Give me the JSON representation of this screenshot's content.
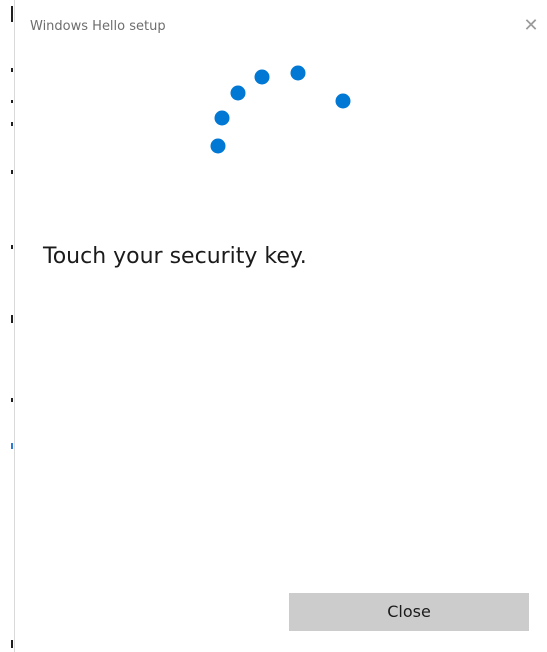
{
  "window": {
    "title": "Windows Hello setup",
    "close_glyph": "✕"
  },
  "main": {
    "prompt": "Touch your security key.",
    "spinner_icon": "progress-dots-icon",
    "accent_color": "#0078d4"
  },
  "footer": {
    "close_label": "Close"
  }
}
